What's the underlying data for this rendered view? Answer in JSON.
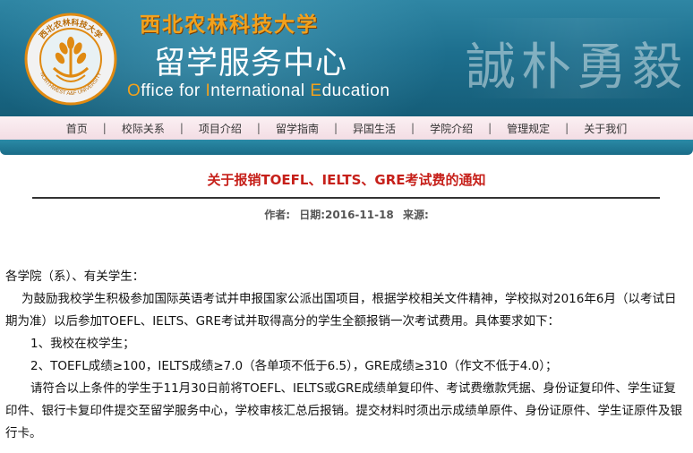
{
  "header": {
    "university_name": "西北农林科技大学",
    "center_name": "留学服务中心",
    "office_en": {
      "parts": [
        {
          "cap": "O",
          "rest": "ffice for "
        },
        {
          "cap": "I",
          "rest": "nternational "
        },
        {
          "cap": "E",
          "rest": "ducation"
        }
      ]
    },
    "motto": "誠朴勇毅",
    "logo": {
      "ring_top_text": "西北农林科技大学",
      "ring_bottom_text": "NORTHWEST A&F UNIVERSITY",
      "icon": "wheat-emblem-icon"
    }
  },
  "nav": {
    "items": [
      "首页",
      "校际关系",
      "项目介绍",
      "留学指南",
      "异国生活",
      "学院介绍",
      "管理规定",
      "关于我们"
    ],
    "separator": "|"
  },
  "article": {
    "title": "关于报销TOEFL、IELTS、GRE考试费的通知",
    "meta": {
      "author_label": "作者:",
      "date_label": "日期:",
      "date": "2016-11-18",
      "source_label": "来源:"
    },
    "paragraphs": {
      "p1": "各学院（系）、有关学生：",
      "p2": "为鼓励我校学生积极参加国际英语考试并申报国家公派出国项目，根据学校相关文件精神，学校拟对2016年6月（以考试日期为准）以后参加TOEFL、IELTS、GRE考试并取得高分的学生全额报销一次考试费用。具体要求如下：",
      "p3": "1、我校在校学生；",
      "p4": "2、TOEFL成绩≥100，IELTS成绩≥7.0（各单项不低于6.5），GRE成绩≥310（作文不低于4.0）；",
      "p5": "请符合以上条件的学生于11月30日前将TOEFL、IELTS或GRE成绩单复印件、考试费缴款凭据、身份证复印件、学生证复印件、银行卡复印件提交至留学服务中心，学校审核汇总后报销。提交材料时须出示成绩单原件、身份证原件、学生证原件及银行卡。"
    }
  },
  "colors": {
    "banner": "#1d6f8e",
    "accent_gold": "#f2a11c",
    "title_red": "#c6201a",
    "nav_bg": "#f3dde4"
  }
}
